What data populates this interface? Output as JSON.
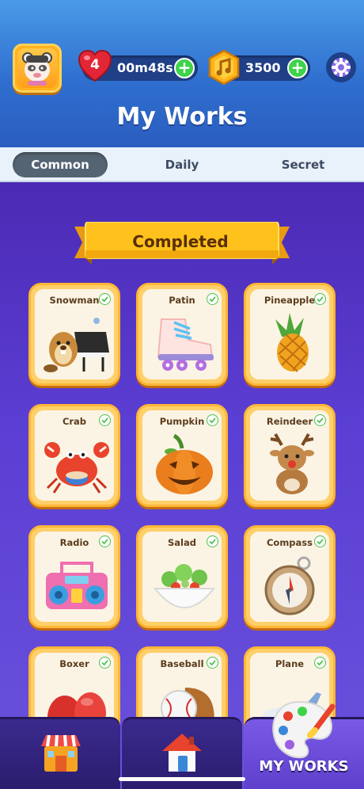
{
  "header": {
    "title": "My Works",
    "lives_count": "4",
    "lives_timer": "00m48s",
    "coins": "3500",
    "avatar_icon": "panda-avatar-icon",
    "heart_icon": "heart-icon",
    "coin_icon": "music-note-coin-icon",
    "settings_icon": "gear-icon"
  },
  "tabs": [
    {
      "label": "Common",
      "active": true
    },
    {
      "label": "Daily",
      "active": false
    },
    {
      "label": "Secret",
      "active": false
    }
  ],
  "section": {
    "ribbon_label": "Completed"
  },
  "works": [
    {
      "name": "Snowman",
      "completed": true
    },
    {
      "name": "Patin",
      "completed": true
    },
    {
      "name": "Pineapple",
      "completed": true
    },
    {
      "name": "Crab",
      "completed": true
    },
    {
      "name": "Pumpkin",
      "completed": true
    },
    {
      "name": "Reindeer",
      "completed": true
    },
    {
      "name": "Radio",
      "completed": true
    },
    {
      "name": "Salad",
      "completed": true
    },
    {
      "name": "Compass",
      "completed": true
    },
    {
      "name": "Boxer",
      "completed": true
    },
    {
      "name": "Baseball",
      "completed": true
    },
    {
      "name": "Plane",
      "completed": true
    }
  ],
  "bottom_nav": {
    "shop_icon": "shop-icon",
    "home_icon": "home-icon",
    "my_works_label": "MY WORKS",
    "palette_icon": "palette-icon"
  },
  "colors": {
    "header_blue": "#2f6fcf",
    "main_purple": "#5b3ed3",
    "card_orange": "#ffb636",
    "check_green": "#4cc24d",
    "ribbon_yellow": "#ffc21c"
  }
}
